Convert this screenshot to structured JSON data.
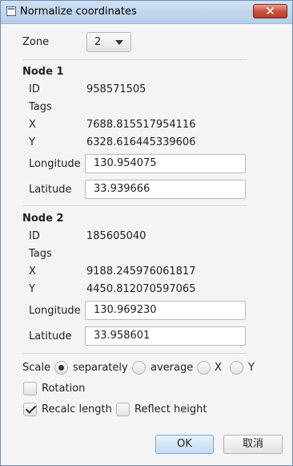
{
  "window": {
    "title": "Normalize coordinates",
    "close_label": "✕"
  },
  "zone": {
    "label": "Zone",
    "value": "2"
  },
  "node1": {
    "heading": "Node 1",
    "id_label": "ID",
    "id": "958571505",
    "tags_label": "Tags",
    "x_label": "X",
    "x": "7688.815517954116",
    "y_label": "Y",
    "y": "6328.616445339606",
    "longitude_label": "Longitude",
    "longitude": "130.954075",
    "latitude_label": "Latitude",
    "latitude": "33.939666"
  },
  "node2": {
    "heading": "Node 2",
    "id_label": "ID",
    "id": "185605040",
    "tags_label": "Tags",
    "x_label": "X",
    "x": "9188.245976061817",
    "y_label": "Y",
    "y": "4450.812070597065",
    "longitude_label": "Longitude",
    "longitude": "130.969230",
    "latitude_label": "Latitude",
    "latitude": "33.958601"
  },
  "scale": {
    "label": "Scale",
    "options": [
      {
        "label": "separately",
        "selected": true
      },
      {
        "label": "average",
        "selected": false
      },
      {
        "label": "X",
        "selected": false
      },
      {
        "label": "Y",
        "selected": false
      }
    ]
  },
  "checkboxes": {
    "rotation": {
      "label": "Rotation",
      "checked": false
    },
    "recalc_length": {
      "label": "Recalc length",
      "checked": true
    },
    "reflect_height": {
      "label": "Reflect height",
      "checked": false
    }
  },
  "buttons": {
    "ok": "OK",
    "cancel": "取消"
  }
}
